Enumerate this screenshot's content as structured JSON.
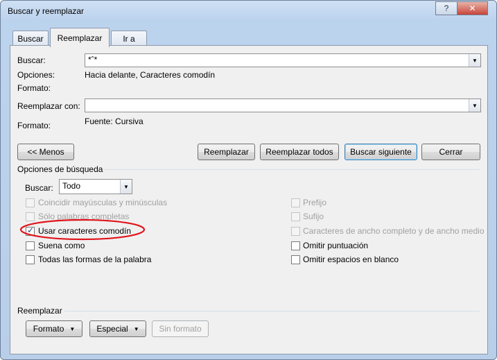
{
  "window": {
    "title": "Buscar y reemplazar",
    "help_label": "?",
    "close_label": "✕"
  },
  "tabs": [
    {
      "label": "Buscar",
      "active": false
    },
    {
      "label": "Reemplazar",
      "active": true
    },
    {
      "label": "Ir a",
      "active": false
    }
  ],
  "find": {
    "label": "Buscar:",
    "value": "*ˆ*",
    "options_label": "Opciones:",
    "options_value": "Hacia delante, Caracteres comodín",
    "format_label": "Formato:"
  },
  "replace": {
    "label": "Reemplazar con:",
    "value": "",
    "format_label": "Formato:",
    "format_value": "Fuente: Cursiva"
  },
  "buttons": {
    "less": "<< Menos",
    "replace": "Reemplazar",
    "replace_all": "Reemplazar todos",
    "find_next": "Buscar siguiente",
    "close": "Cerrar"
  },
  "search_options": {
    "heading": "Opciones de búsqueda",
    "search_label": "Buscar:",
    "search_value": "Todo",
    "left": [
      {
        "label": "Coincidir mayúsculas y minúsculas",
        "checked": false,
        "enabled": false
      },
      {
        "label": "Sólo palabras completas",
        "checked": false,
        "enabled": false
      },
      {
        "label": "Usar caracteres comodín",
        "checked": true,
        "enabled": true
      },
      {
        "label": "Suena como",
        "checked": false,
        "enabled": true
      },
      {
        "label": "Todas las formas de la palabra",
        "checked": false,
        "enabled": true
      }
    ],
    "right": [
      {
        "label": "Prefijo",
        "checked": false,
        "enabled": false
      },
      {
        "label": "Sufijo",
        "checked": false,
        "enabled": false
      },
      {
        "label": "Caracteres de ancho completo y de ancho medio",
        "checked": false,
        "enabled": false
      },
      {
        "label": "Omitir puntuación",
        "checked": false,
        "enabled": true
      },
      {
        "label": "Omitir espacios en blanco",
        "checked": false,
        "enabled": true
      }
    ]
  },
  "replace_section": {
    "heading": "Reemplazar",
    "format_button": "Formato",
    "special_button": "Especial",
    "no_format_button": "Sin formato"
  },
  "colors": {
    "annotation_circle": "#e0141b",
    "title_gradient": "#bcd3ee",
    "focus_border": "#3c7fb1"
  }
}
